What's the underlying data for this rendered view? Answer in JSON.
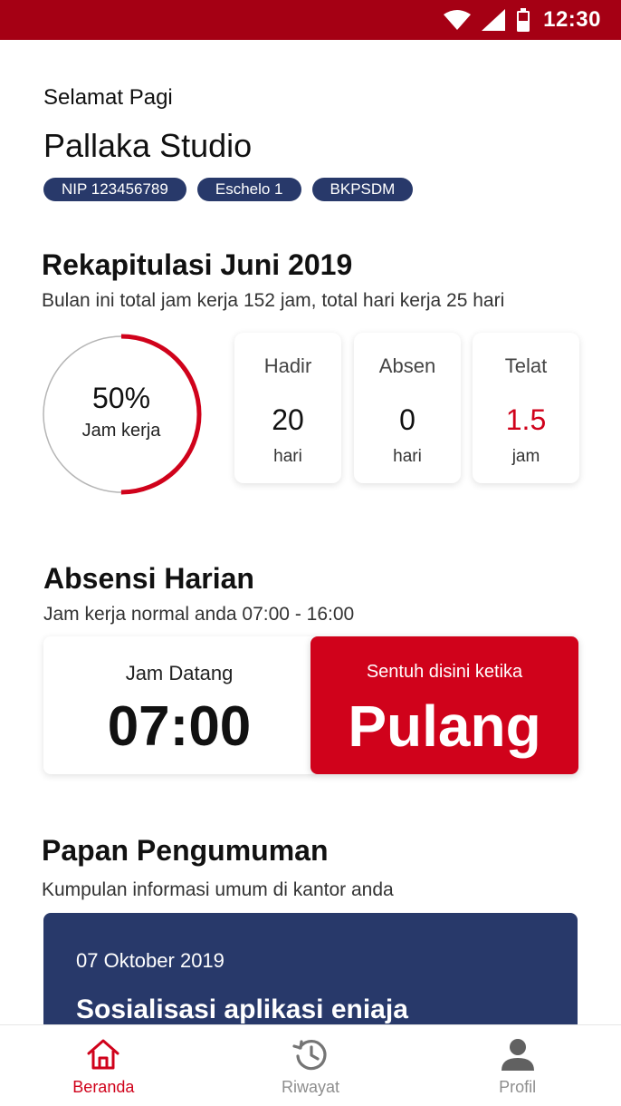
{
  "status_bar": {
    "time": "12:30"
  },
  "header": {
    "greeting": "Selamat Pagi",
    "name": "Pallaka Studio",
    "badges": [
      "NIP 123456789",
      "Eschelo 1",
      "BKPSDM"
    ]
  },
  "recap": {
    "title": "Rekapitulasi Juni 2019",
    "subtitle": "Bulan ini total jam kerja 152 jam, total hari kerja 25 hari",
    "progress": {
      "percent_text": "50%",
      "label": "Jam kerja",
      "value": 0.5
    },
    "stats": [
      {
        "label": "Hadir",
        "value": "20",
        "unit": "hari"
      },
      {
        "label": "Absen",
        "value": "0",
        "unit": "hari"
      },
      {
        "label": "Telat",
        "value": "1.5",
        "unit": "jam"
      }
    ]
  },
  "attendance": {
    "title": "Absensi Harian",
    "subtitle": "Jam kerja normal anda 07:00 - 16:00",
    "arrival_label": "Jam Datang",
    "arrival_time": "07:00",
    "checkout_hint": "Sentuh disini ketika",
    "checkout_action": "Pulang"
  },
  "board": {
    "title": "Papan Pengumuman",
    "subtitle": "Kumpulan informasi umum di kantor anda",
    "announcement": {
      "date": "07 Oktober 2019",
      "headline": "Sosialisasi aplikasi eniaja"
    }
  },
  "nav": {
    "items": [
      {
        "label": "Beranda",
        "icon": "home-icon",
        "active": true
      },
      {
        "label": "Riwayat",
        "icon": "history-icon",
        "active": false
      },
      {
        "label": "Profil",
        "icon": "profile-icon",
        "active": false
      }
    ]
  },
  "colors": {
    "primary_red": "#d0021b",
    "status_bar": "#a50014",
    "navy": "#28396a"
  }
}
